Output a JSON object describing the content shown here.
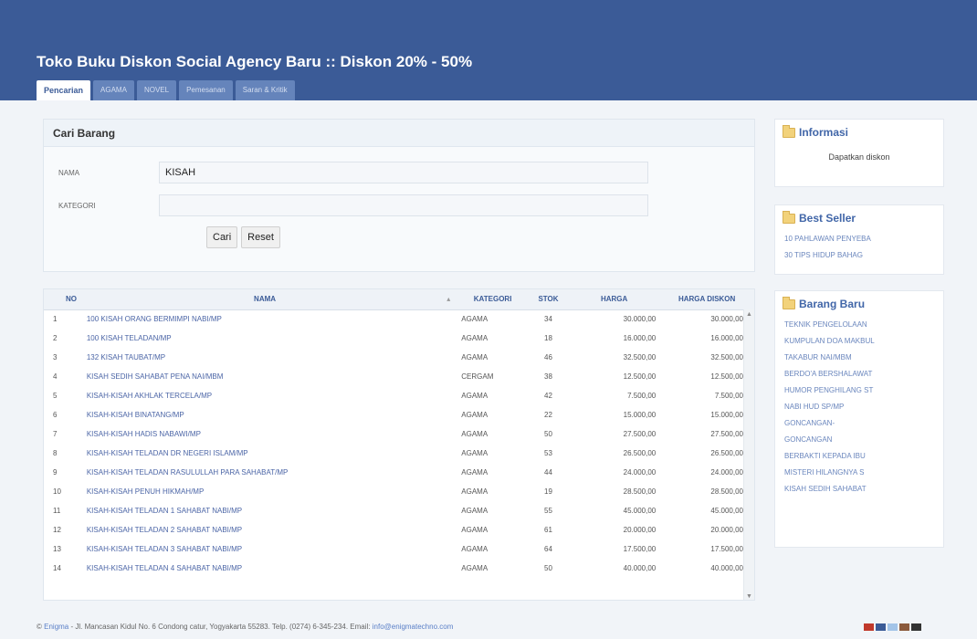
{
  "header": {
    "title": "Toko Buku Diskon Social Agency Baru :: Diskon 20% - 50%",
    "tabs": [
      {
        "label": "Pencarian",
        "active": true
      },
      {
        "label": "AGAMA",
        "active": false
      },
      {
        "label": "NOVEL",
        "active": false
      },
      {
        "label": "Pemesanan",
        "active": false
      },
      {
        "label": "Saran & Kritik",
        "active": false
      }
    ]
  },
  "search": {
    "title": "Cari Barang",
    "nama_label": "NAMA",
    "nama_value": "KISAH",
    "kategori_label": "KATEGORI",
    "kategori_value": "",
    "cari_label": "Cari",
    "reset_label": "Reset"
  },
  "table": {
    "columns": {
      "no": "NO",
      "nama": "NAMA",
      "kategori": "KATEGORI",
      "stok": "STOK",
      "harga": "HARGA",
      "diskon": "HARGA DISKON"
    },
    "rows": [
      {
        "no": "1",
        "nama": "100 KISAH ORANG BERMIMPI NABI/MP",
        "kategori": "AGAMA",
        "stok": "34",
        "harga": "30.000,00",
        "diskon": "30.000,00"
      },
      {
        "no": "2",
        "nama": "100 KISAH TELADAN/MP",
        "kategori": "AGAMA",
        "stok": "18",
        "harga": "16.000,00",
        "diskon": "16.000,00"
      },
      {
        "no": "3",
        "nama": "132 KISAH TAUBAT/MP",
        "kategori": "AGAMA",
        "stok": "46",
        "harga": "32.500,00",
        "diskon": "32.500,00"
      },
      {
        "no": "4",
        "nama": "KISAH SEDIH SAHABAT PENA NAI/MBM",
        "kategori": "CERGAM",
        "stok": "38",
        "harga": "12.500,00",
        "diskon": "12.500,00"
      },
      {
        "no": "5",
        "nama": "KISAH-KISAH AKHLAK TERCELA/MP",
        "kategori": "AGAMA",
        "stok": "42",
        "harga": "7.500,00",
        "diskon": "7.500,00"
      },
      {
        "no": "6",
        "nama": "KISAH-KISAH BINATANG/MP",
        "kategori": "AGAMA",
        "stok": "22",
        "harga": "15.000,00",
        "diskon": "15.000,00"
      },
      {
        "no": "7",
        "nama": "KISAH-KISAH HADIS NABAWI/MP",
        "kategori": "AGAMA",
        "stok": "50",
        "harga": "27.500,00",
        "diskon": "27.500,00"
      },
      {
        "no": "8",
        "nama": "KISAH-KISAH TELADAN DR NEGERI ISLAM/MP",
        "kategori": "AGAMA",
        "stok": "53",
        "harga": "26.500,00",
        "diskon": "26.500,00"
      },
      {
        "no": "9",
        "nama": "KISAH-KISAH TELADAN RASULULLAH PARA SAHABAT/MP",
        "kategori": "AGAMA",
        "stok": "44",
        "harga": "24.000,00",
        "diskon": "24.000,00"
      },
      {
        "no": "10",
        "nama": "KISAH-KISAH PENUH HIKMAH/MP",
        "kategori": "AGAMA",
        "stok": "19",
        "harga": "28.500,00",
        "diskon": "28.500,00"
      },
      {
        "no": "11",
        "nama": "KISAH-KISAH TELADAN 1 SAHABAT NABI/MP",
        "kategori": "AGAMA",
        "stok": "55",
        "harga": "45.000,00",
        "diskon": "45.000,00"
      },
      {
        "no": "12",
        "nama": "KISAH-KISAH TELADAN 2 SAHABAT NABI/MP",
        "kategori": "AGAMA",
        "stok": "61",
        "harga": "20.000,00",
        "diskon": "20.000,00"
      },
      {
        "no": "13",
        "nama": "KISAH-KISAH TELADAN 3 SAHABAT NABI/MP",
        "kategori": "AGAMA",
        "stok": "64",
        "harga": "17.500,00",
        "diskon": "17.500,00"
      },
      {
        "no": "14",
        "nama": "KISAH-KISAH TELADAN 4 SAHABAT NABI/MP",
        "kategori": "AGAMA",
        "stok": "50",
        "harga": "40.000,00",
        "diskon": "40.000,00"
      }
    ]
  },
  "sidebar": {
    "info": {
      "title": "Informasi",
      "text": "Dapatkan diskon"
    },
    "best": {
      "title": "Best Seller",
      "items": [
        "10 PAHLAWAN PENYEBA",
        "30 TIPS HIDUP BAHAG"
      ]
    },
    "baru": {
      "title": "Barang Baru",
      "items": [
        "TEKNIK PENGELOLAAN",
        "KUMPULAN DOA MAKBUL",
        "TAKABUR NAI/MBM",
        "BERDO'A BERSHALAWAT",
        "HUMOR PENGHILANG ST",
        "NABI HUD SP/MP",
        "GONCANGAN-",
        "GONCANGAN",
        "BERBAKTI KEPADA IBU",
        "MISTERI HILANGNYA S",
        "KISAH SEDIH SAHABAT"
      ]
    }
  },
  "footer": {
    "brand": "Enigma",
    "text": " - Jl. Mancasan Kidul No. 6 Condong catur, Yogyakarta 55283. Telp. (0274) 6-345-234. Email: ",
    "email": "info@enigmatechno.com",
    "swatch_colors": [
      "#c0392b",
      "#3b5b97",
      "#a3c4e8",
      "#8b5a3c",
      "#333333"
    ]
  },
  "colors": {
    "header": "#3b5b97",
    "link": "#4b65a6"
  }
}
